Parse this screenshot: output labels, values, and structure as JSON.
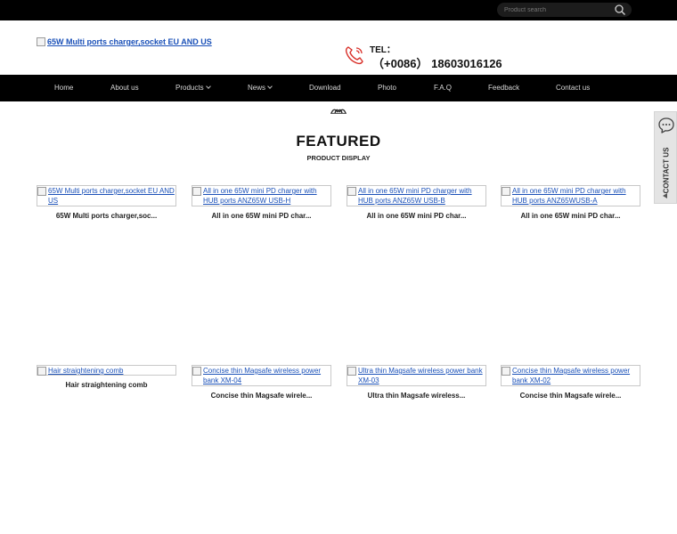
{
  "topbar": {
    "search_placeholder": "Product search"
  },
  "header": {
    "logo_alt": "65W Multi ports charger,socket EU AND US",
    "tel_label": "TEL：",
    "tel_number": "（+0086） 18603016126"
  },
  "nav": {
    "items": [
      {
        "label": "Home"
      },
      {
        "label": "About us"
      },
      {
        "label": "Products"
      },
      {
        "label": "News"
      },
      {
        "label": "Download"
      },
      {
        "label": "Photo"
      },
      {
        "label": "F.A.Q"
      },
      {
        "label": "Feedback"
      },
      {
        "label": "Contact us"
      }
    ]
  },
  "featured": {
    "title": "FEATURED",
    "subtitle": "PRODUCT DISPLAY",
    "products": [
      {
        "alt": "65W Multi ports charger,socket EU AND US",
        "name": "65W Multi ports charger,soc..."
      },
      {
        "alt": "All in one 65W mini PD charger with HUB ports ANZ65W USB-H",
        "name": "All in one 65W mini PD char..."
      },
      {
        "alt": "All in one 65W mini PD charger with HUB ports ANZ65W USB-B",
        "name": "All in one 65W mini PD char..."
      },
      {
        "alt": "All in one 65W mini PD charger with HUB ports ANZ65WUSB-A",
        "name": "All in one 65W mini PD char..."
      },
      {
        "alt": "Hair straightening comb",
        "name": "Hair straightening comb"
      },
      {
        "alt": "Concise thin Magsafe wireless power bank XM-04",
        "name": "Concise thin Magsafe wirele..."
      },
      {
        "alt": "Ultra thin Magsafe wireless power bank XM-03",
        "name": "Ultra thin Magsafe wireless..."
      },
      {
        "alt": "Concise thin Magsafe wireless power bank XM-02",
        "name": "Concise thin Magsafe wirele..."
      }
    ]
  },
  "contact_tab": {
    "label": "CONTACT US"
  },
  "colors": {
    "topbar": "#000000",
    "nav_bg": "#000000",
    "link": "#1a50b8",
    "phone_icon": "#d9322b"
  }
}
